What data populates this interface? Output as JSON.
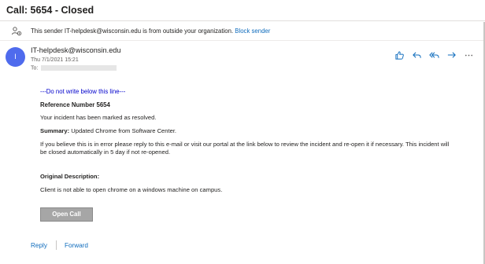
{
  "window": {
    "title": "Call: 5654 - Closed"
  },
  "external_banner": {
    "icon": "person-external-icon",
    "text": "This sender IT-helpdesk@wisconsin.edu is from outside your organization.",
    "link": "Block sender"
  },
  "header": {
    "avatar_initial": "I",
    "sender": "IT-helpdesk@wisconsin.edu",
    "date": "Thu 7/1/2021 15:21",
    "to_label": "To:"
  },
  "actions": [
    {
      "name": "like-icon"
    },
    {
      "name": "reply-icon"
    },
    {
      "name": "reply-all-icon"
    },
    {
      "name": "forward-icon"
    },
    {
      "name": "more-icon"
    }
  ],
  "message": {
    "divider_note": "---Do not write below this line---",
    "reference": "Reference Number 5654",
    "resolved": "Your incident has been marked as resolved.",
    "summary_label": "Summary:",
    "summary_text": " Updated Chrome from Software Center.",
    "paragraph": "If you believe this is in error please reply to this e-mail or visit our portal at the link below to review the incident and re-open it if necessary. This incident will be closed automatically in 5 day if not re-opened.",
    "original_label": "Original Description:",
    "original_text": "Client is not able to open chrome on a windows machine on campus.",
    "button": "Open Call"
  },
  "footer": {
    "reply": "Reply",
    "forward": "Forward"
  },
  "colors": {
    "accent": "#0f6cbd",
    "avatar": "#4f6bed",
    "divider_note": "#0000cc",
    "button": "#a6a6a6"
  }
}
